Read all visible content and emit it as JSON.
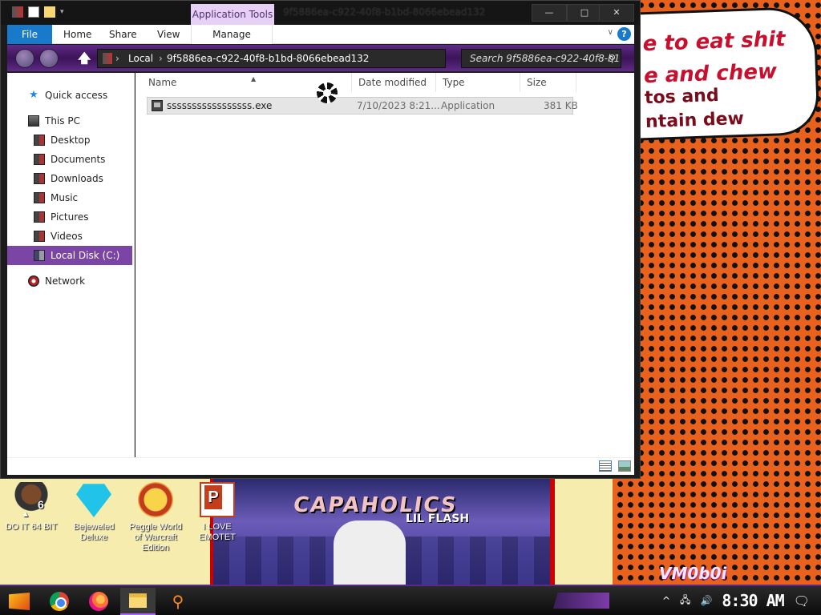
{
  "window": {
    "title": "9f5886ea-c922-40f8-b1bd-8066ebead132",
    "context_tab": "Application Tools",
    "controls": {
      "minimize": "—",
      "maximize": "□",
      "close": "✕"
    }
  },
  "ribbon": {
    "tabs": [
      "File",
      "Home",
      "Share",
      "View",
      "Manage"
    ],
    "help": "?",
    "collapse": "∨"
  },
  "nav": {
    "up": "🡅",
    "address": [
      "Local",
      "9f5886ea-c922-40f8-b1bd-8066ebead132"
    ],
    "separator": "›",
    "search_placeholder": "Search 9f5886ea-c922-40f8-b1b...",
    "search_icon": "⚲"
  },
  "sidebar": {
    "items": [
      {
        "label": "Quick access",
        "icon": "star-icon"
      },
      {
        "label": "This PC",
        "icon": "computer-icon"
      },
      {
        "label": "Desktop",
        "icon": "desktop-icon"
      },
      {
        "label": "Documents",
        "icon": "documents-icon"
      },
      {
        "label": "Downloads",
        "icon": "downloads-icon"
      },
      {
        "label": "Music",
        "icon": "music-icon"
      },
      {
        "label": "Pictures",
        "icon": "pictures-icon"
      },
      {
        "label": "Videos",
        "icon": "videos-icon"
      },
      {
        "label": "Local Disk (C:)",
        "icon": "disk-icon",
        "selected": true
      },
      {
        "label": "Network",
        "icon": "network-icon"
      }
    ]
  },
  "columns": [
    "Name",
    "Date modified",
    "Type",
    "Size"
  ],
  "files": [
    {
      "name": "sssssssssssssssss.exe",
      "date": "7/10/2023 8:21...",
      "type": "Application",
      "size": "381 KB"
    }
  ],
  "desktop": {
    "speech_lines": [
      "e to eat shit",
      "e and chew",
      "tos and",
      "ntain dew"
    ],
    "album_title": "CAPAHOLICS",
    "album_sub": "LIL FLASH",
    "watermark": "VM0b0i",
    "icons": [
      {
        "label": "DO IT 64 BIT",
        "icon": "person-icon",
        "badge": "6"
      },
      {
        "label": "Bejeweled Deluxe",
        "icon": "gem-icon"
      },
      {
        "label": "Peggle World of Warcraft Edition",
        "icon": "peggle-icon"
      },
      {
        "label": "I LOVE EMOTET",
        "icon": "powerpoint-icon"
      }
    ]
  },
  "taskbar": {
    "clock": "8:30 AM",
    "tray": {
      "chevron": "^",
      "network": "🖧",
      "volume": "🔊",
      "notifications": "🗨"
    }
  },
  "colors": {
    "accent_purple": "#7b45a6",
    "file_tab_blue": "#1979ca",
    "wallpaper_orange": "#e8621e"
  }
}
